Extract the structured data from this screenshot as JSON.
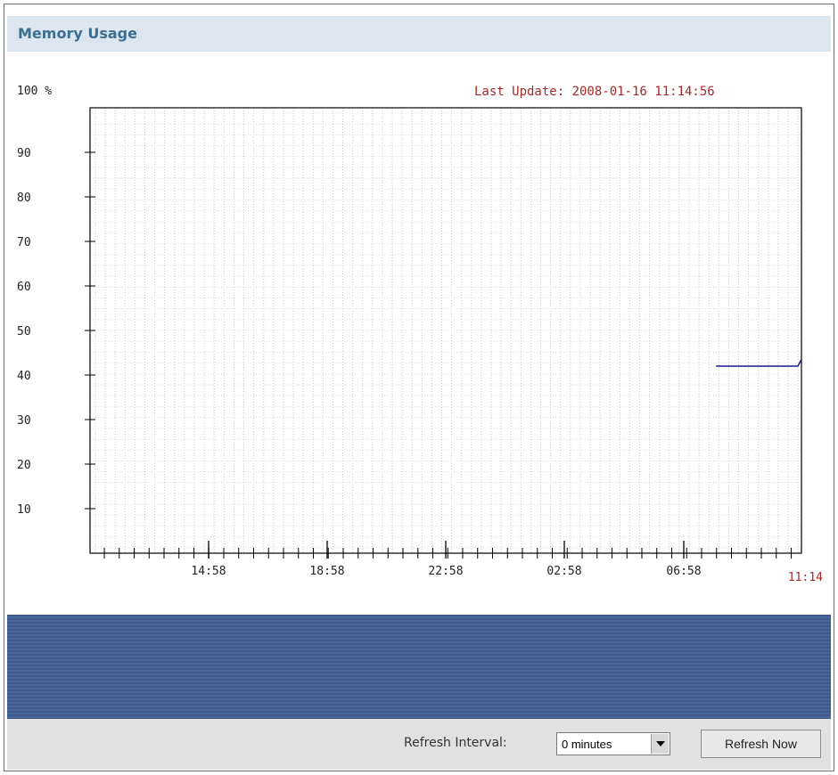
{
  "panel": {
    "title": "Memory Usage"
  },
  "chart_data": {
    "type": "line",
    "title": "",
    "y_axis_top_label": "100 %",
    "last_update": "Last Update: 2008-01-16 11:14:56",
    "y_ticks": [
      "90",
      "80",
      "70",
      "60",
      "50",
      "40",
      "30",
      "20",
      "10"
    ],
    "y_range": [
      0,
      100
    ],
    "x_tick_labels": [
      "14:58",
      "18:58",
      "22:58",
      "02:58",
      "06:58"
    ],
    "x_end_label": "11:14",
    "grid": true,
    "series": [
      {
        "color": "#1a1a8c",
        "points": [
          [
            0.88,
            42
          ],
          [
            0.995,
            42
          ],
          [
            1.0,
            43.5
          ]
        ]
      }
    ]
  },
  "footer": {
    "refresh_label": "Refresh Interval:",
    "refresh_value": "0 minutes",
    "refresh_button": "Refresh Now"
  }
}
